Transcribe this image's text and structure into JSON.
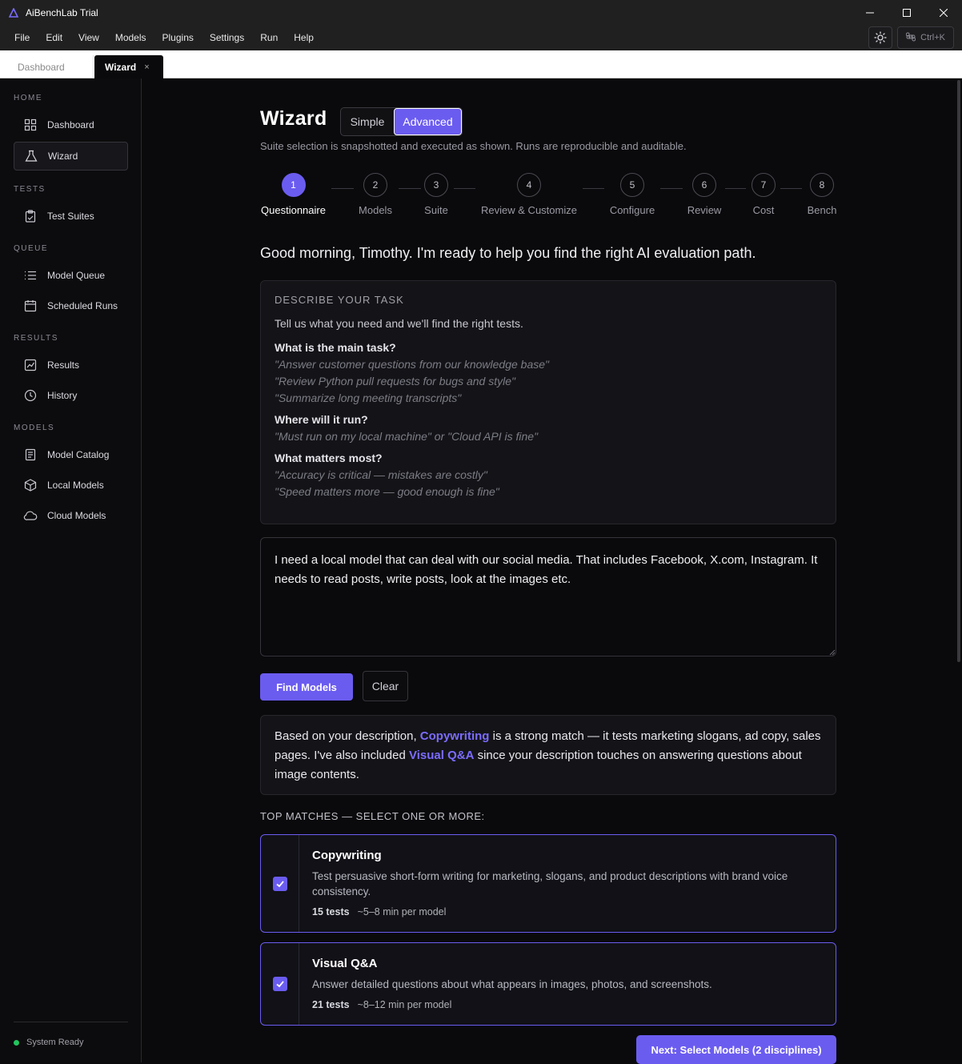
{
  "window": {
    "title": "AiBenchLab Trial"
  },
  "menu": [
    "File",
    "Edit",
    "View",
    "Models",
    "Plugins",
    "Settings",
    "Run",
    "Help"
  ],
  "shortcut_hint": "Ctrl+K",
  "tabs": [
    {
      "label": "Dashboard"
    },
    {
      "label": "Wizard",
      "close": "×"
    }
  ],
  "sidebar": {
    "sections": {
      "home": "HOME",
      "tests": "TESTS",
      "queue": "QUEUE",
      "results": "RESULTS",
      "models": "MODELS"
    },
    "items": {
      "dashboard": "Dashboard",
      "wizard": "Wizard",
      "test_suites": "Test Suites",
      "model_queue": "Model Queue",
      "scheduled_runs": "Scheduled Runs",
      "results": "Results",
      "history": "History",
      "model_catalog": "Model Catalog",
      "local_models": "Local Models",
      "cloud_models": "Cloud Models"
    },
    "status": "System Ready",
    "status_color": "#22c55e"
  },
  "wizard": {
    "title": "Wizard",
    "mode": {
      "simple": "Simple",
      "advanced": "Advanced",
      "selected": "Advanced"
    },
    "subtitle": "Suite selection is snapshotted and executed as shown. Runs are reproducible and auditable.",
    "steps": [
      {
        "num": "1",
        "label": "Questionnaire"
      },
      {
        "num": "2",
        "label": "Models"
      },
      {
        "num": "3",
        "label": "Suite"
      },
      {
        "num": "4",
        "label": "Review & Customize"
      },
      {
        "num": "5",
        "label": "Configure"
      },
      {
        "num": "6",
        "label": "Review"
      },
      {
        "num": "7",
        "label": "Cost"
      },
      {
        "num": "8",
        "label": "Bench"
      }
    ],
    "active_step": 1,
    "greeting": "Good morning, Timothy. I'm ready to help you find the right AI evaluation path.",
    "describe": {
      "heading": "DESCRIBE YOUR TASK",
      "intro": "Tell us what you need and we'll find the right tests.",
      "q1": "What is the main task?",
      "q1_examples": [
        "\"Answer customer questions from our knowledge base\"",
        "\"Review Python pull requests for bugs and style\"",
        "\"Summarize long meeting transcripts\""
      ],
      "q2": "Where will it run?",
      "q2_examples": [
        "\"Must run on my local machine\" or \"Cloud API is fine\""
      ],
      "q3": "What matters most?",
      "q3_examples": [
        "\"Accuracy is critical — mistakes are costly\"",
        "\"Speed matters more — good enough is fine\""
      ]
    },
    "task_input": "I need a local model that can deal with our social media. That includes Facebook, X.com, Instagram. It needs to read posts, write posts, look at the images etc.",
    "find_button": "Find Models",
    "clear_button": "Clear",
    "explanation": {
      "p1": "Based on your description, ",
      "m1": "Copywriting",
      "p2": " is a strong match — it tests marketing slogans, ad copy, sales pages. I've also included ",
      "m2": "Visual Q&A",
      "p3": " since your description touches on answering questions about image contents."
    },
    "top_matches_label": "TOP MATCHES — SELECT ONE OR MORE:",
    "matches": [
      {
        "name": "Copywriting",
        "desc": "Test persuasive short-form writing for marketing, slogans, and product descriptions with brand voice consistency.",
        "tests": "15 tests",
        "time": "~5–8 min per model",
        "checked": true
      },
      {
        "name": "Visual Q&A",
        "desc": "Answer detailed questions about what appears in images, photos, and screenshots.",
        "tests": "21 tests",
        "time": "~8–12 min per model",
        "checked": true
      }
    ],
    "next_button": "Next: Select Models (2 disciplines)"
  },
  "colors": {
    "accent": "#6b5cf0",
    "background": "#0a0a0c",
    "card": "#141418"
  }
}
